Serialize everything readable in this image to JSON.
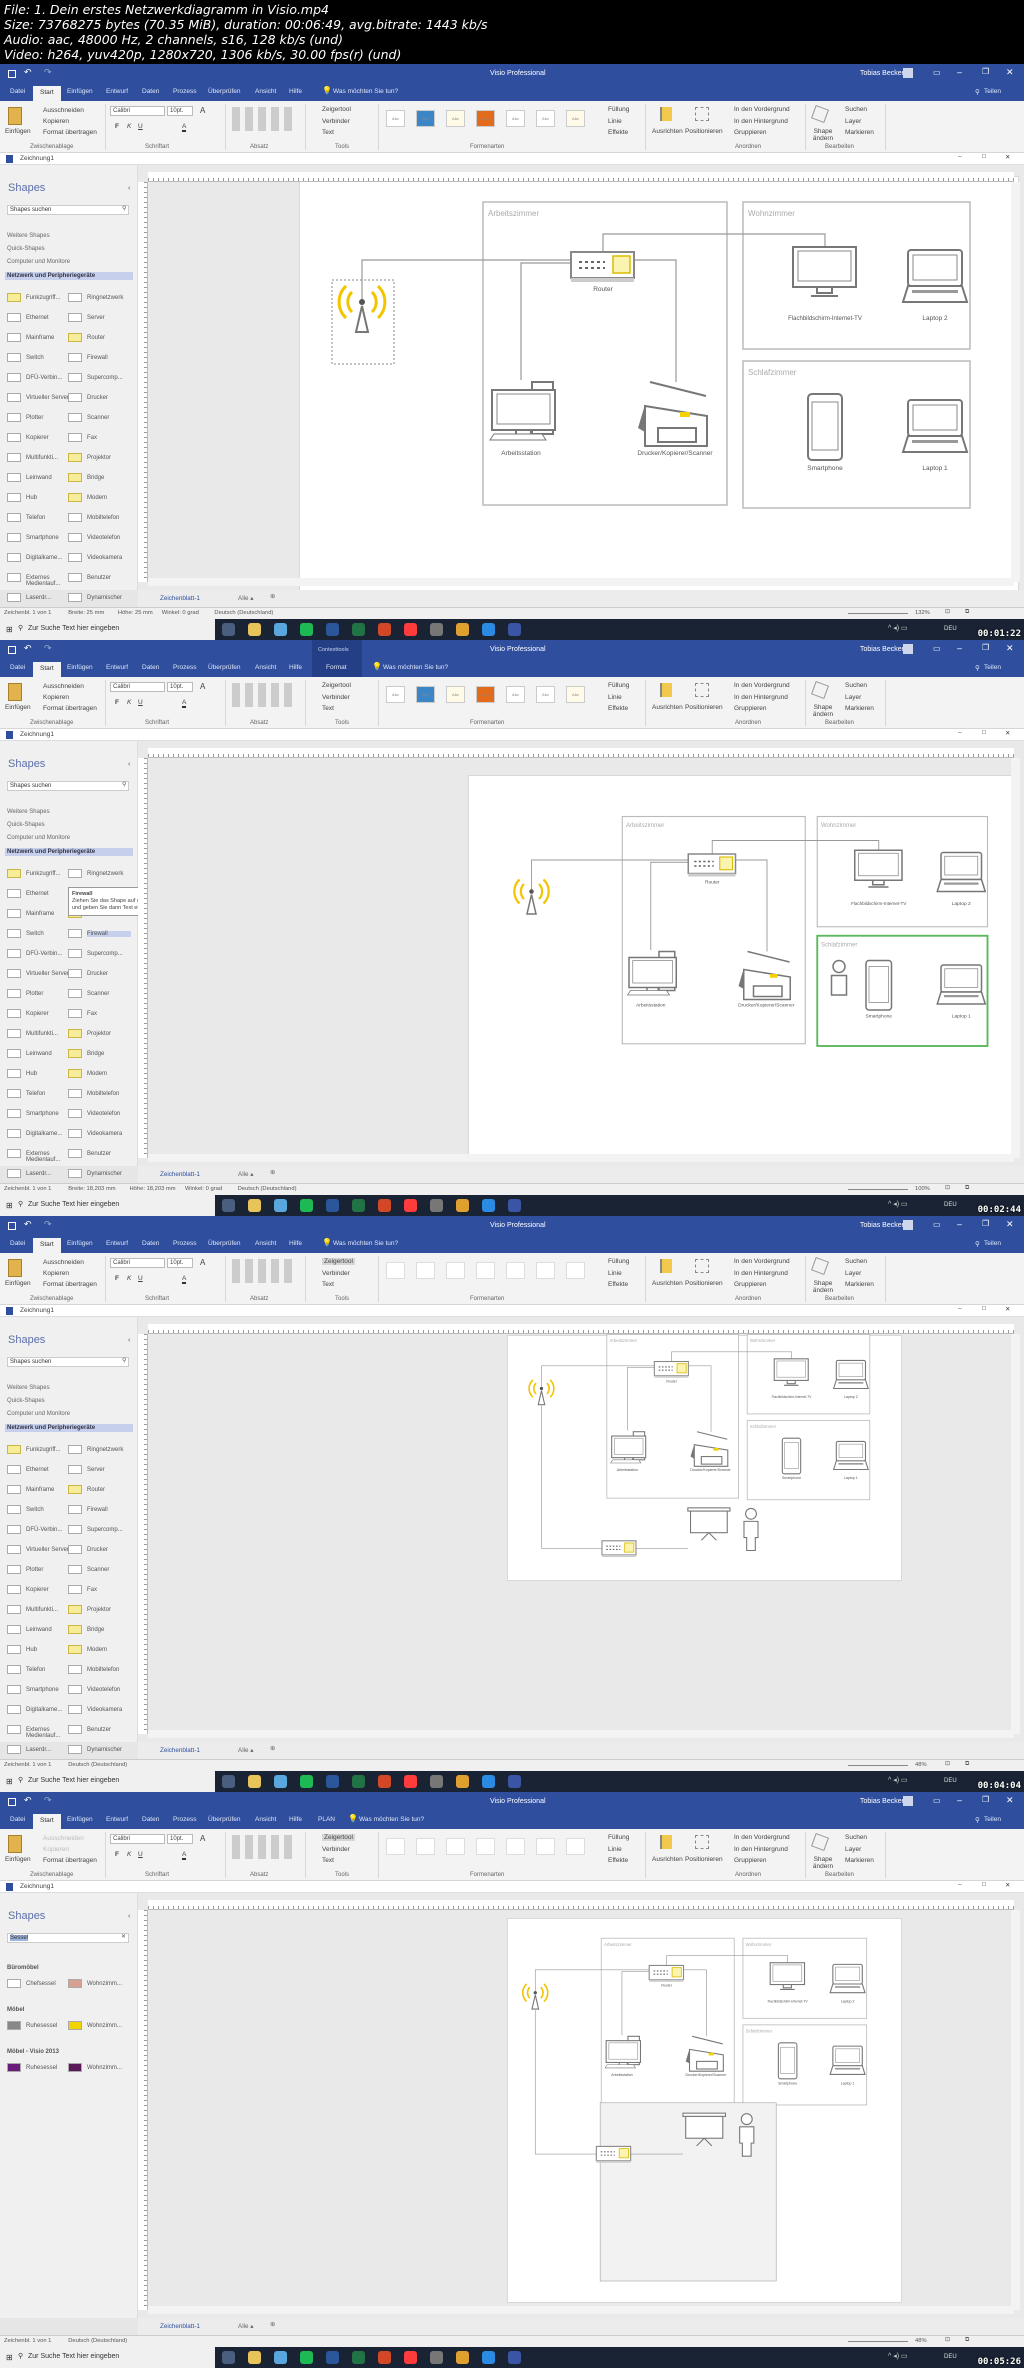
{
  "header": {
    "lines": [
      "File: 1. Dein erstes Netzwerkdiagramm in Visio.mp4",
      "Size: 73768275 bytes (70.35 MiB), duration: 00:06:49, avg.bitrate: 1443 kb/s",
      "Audio: aac, 48000 Hz, 2 channels, s16, 128 kb/s (und)",
      "Video: h264, yuv420p, 1280x720, 1306 kb/s, 30.00 fps(r) (und)"
    ]
  },
  "app": {
    "title": "Visio Professional",
    "user": "Tobias Becker",
    "share": "Teilen",
    "tabs": [
      "Datei",
      "Start",
      "Einfügen",
      "Entwurf",
      "Daten",
      "Prozess",
      "Überprüfen",
      "Ansicht",
      "Hilfe"
    ],
    "tell_me": "Was möchten Sie tun?",
    "document": "Zeichnung1",
    "clipboard": {
      "paste": "Einfügen",
      "cut": "Ausschneiden",
      "copy": "Kopieren",
      "format": "Format übertragen",
      "label": "Zwischenablage"
    },
    "font": {
      "name": "Calibri",
      "size": "10pt.",
      "label": "Schriftart"
    },
    "paragraph": {
      "label": "Absatz"
    },
    "tools": {
      "pointer": "Zeigertool",
      "connector": "Verbinder",
      "text": "Text",
      "label": "Tools"
    },
    "styles": {
      "label": "Formenarten",
      "fill": "Füllung",
      "line": "Linie",
      "effects": "Effekte",
      "tile": "Abc"
    },
    "arrange": {
      "align": "Ausrichten",
      "position": "Positionieren",
      "front": "In den Vordergrund",
      "back": "In den Hintergrund",
      "group": "Gruppieren",
      "label": "Anordnen"
    },
    "edit": {
      "change": "Shape ändern",
      "find": "Suchen",
      "layer": "Layer",
      "select": "Markieren",
      "label": "Bearbeiten"
    },
    "shapes": {
      "title": "Shapes",
      "search_placeholder": "Shapes suchen",
      "menu": [
        "Weitere Shapes",
        "Quick-Shapes",
        "Computer und Monitore",
        "Netzwerk und Peripheriegeräte"
      ],
      "stencil": [
        [
          "Funkzugriff...",
          "Ringnetzwerk"
        ],
        [
          "Ethernet",
          "Server"
        ],
        [
          "Mainframe",
          "Router"
        ],
        [
          "Switch",
          "Firewall"
        ],
        [
          "DFÜ-Verbin...",
          "Supercomp..."
        ],
        [
          "Virtueller Server",
          "Drucker"
        ],
        [
          "Plotter",
          "Scanner"
        ],
        [
          "Kopierer",
          "Fax"
        ],
        [
          "Multifunkti...",
          "Projektor"
        ],
        [
          "Leinwand",
          "Bridge"
        ],
        [
          "Hub",
          "Modem"
        ],
        [
          "Telefon",
          "Mobiltelefon"
        ],
        [
          "Smartphone",
          "Videotelefon"
        ],
        [
          "Digitalkame...",
          "Videokamera"
        ],
        [
          "Externes Medienlauf...",
          "Benutzer"
        ],
        [
          "Laserdr...",
          "Dynamischer"
        ]
      ]
    },
    "sheet_tab": "Zeichenblatt-1",
    "sheet_all": "Alle ▴",
    "taskbar": {
      "search": "Zur Suche Text hier eingeben",
      "lang": "DEU"
    },
    "colors": {
      "title_bar": "#2f4f9e",
      "accent_yellow": "#f2c500",
      "ribbon": "#f3f3f3"
    }
  },
  "diagram": {
    "rooms": {
      "office": "Arbeitszimmer",
      "living": "Wohnzimmer",
      "bedroom": "Schlafzimmer"
    },
    "labels": {
      "router": "Router",
      "tv": "Flachbildschirm-Internet-TV",
      "laptop2": "Laptop 2",
      "workstation": "Arbeitsstation",
      "printer": "Drucker/Kopierer/Scanner",
      "smartphone": "Smartphone",
      "laptop1": "Laptop 1"
    }
  },
  "frames": [
    {
      "timestamp": "00:01:22",
      "zoom": "132%",
      "status": [
        "Zeichenbl. 1 von 1",
        "Breite: 25 mm",
        "Höhe: 25 mm",
        "Winkel: 0 grad",
        "Deutsch (Deutschland)"
      ]
    },
    {
      "timestamp": "00:02:44",
      "zoom": "100%",
      "context_group": "Contexttools",
      "context_tab": "Format",
      "tooltip": {
        "title": "Firewall",
        "text": "Ziehen Sie das Shape auf das Zeichenblatt, und geben Sie dann Text ein."
      },
      "status": [
        "Zeichenbl. 1 von 1",
        "Breite: 18,203 mm",
        "Höhe: 18,203 mm",
        "Winkel: 0 grad",
        "Deutsch (Deutschland)"
      ]
    },
    {
      "timestamp": "00:04:04",
      "zoom": "48%",
      "status": [
        "Zeichenbl. 1 von 1",
        "Deutsch (Deutschland)"
      ]
    },
    {
      "timestamp": "00:05:26",
      "zoom": "48%",
      "extra_tab": "PLAN",
      "status": [
        "Zeichenbl. 1 von 1",
        "Deutsch (Deutschland)"
      ],
      "search": {
        "value": "Sessel",
        "groups": [
          {
            "title": "Büromöbel",
            "items": [
              "Chefsessel",
              "Wohnzimm..."
            ]
          },
          {
            "title": "Möbel",
            "items": [
              "Ruhesessel",
              "Wohnzimm..."
            ]
          },
          {
            "title": "Möbel - Visio 2013",
            "items": [
              "Ruhesessel",
              "Wohnzimm..."
            ]
          }
        ]
      }
    }
  ]
}
